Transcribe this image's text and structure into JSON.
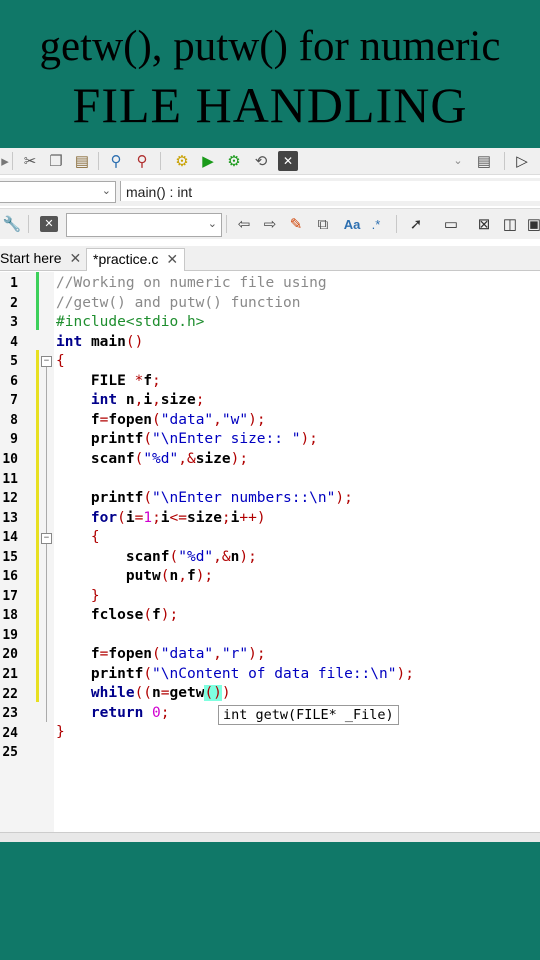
{
  "banner": {
    "line1": "getw(), putw() for numeric",
    "line2": "FILE HANDLING"
  },
  "toolbar": {
    "scope_selector": "",
    "function_selector": "main() : int",
    "search_combo": ""
  },
  "tabs": [
    {
      "label": "Start here",
      "close": "✕"
    },
    {
      "label": "*practice.c",
      "close": "✕"
    }
  ],
  "editor": {
    "line_numbers": [
      "1",
      "2",
      "3",
      "4",
      "5",
      "6",
      "7",
      "8",
      "9",
      "10",
      "11",
      "12",
      "13",
      "14",
      "15",
      "16",
      "17",
      "18",
      "19",
      "20",
      "21",
      "22",
      "23",
      "24",
      "25"
    ],
    "tooltip": "int getw(FILE* _File)"
  },
  "colors": {
    "banner_bg": "#107868",
    "comment": "#8a8a8a",
    "keyword": "#00008b",
    "string": "#0000c0",
    "preprocessor": "#1e8e2e"
  }
}
